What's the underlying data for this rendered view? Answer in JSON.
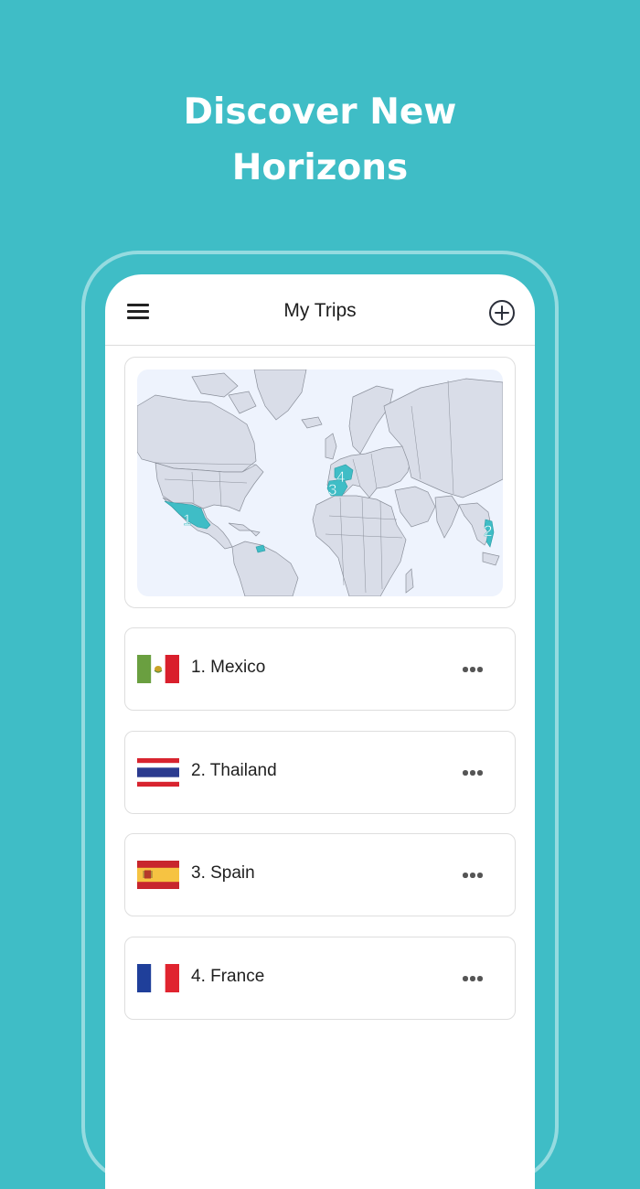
{
  "headline": {
    "line1": "Discover New",
    "line2": "Horizons"
  },
  "appbar": {
    "title": "My Trips",
    "menu_icon": "hamburger-menu-icon",
    "add_icon": "add-circle-icon"
  },
  "map": {
    "accent_color": "#3fbdc6",
    "markers": [
      "1",
      "2",
      "3",
      "4"
    ]
  },
  "trips": [
    {
      "label": "1. Mexico",
      "flag": "mexico-flag-icon"
    },
    {
      "label": "2. Thailand",
      "flag": "thailand-flag-icon"
    },
    {
      "label": "3. Spain",
      "flag": "spain-flag-icon"
    },
    {
      "label": "4. France",
      "flag": "france-flag-icon"
    }
  ],
  "colors": {
    "background": "#3fbdc6",
    "card_border": "#dedede",
    "map_background": "#eef3fd",
    "land": "#d9dde8"
  }
}
